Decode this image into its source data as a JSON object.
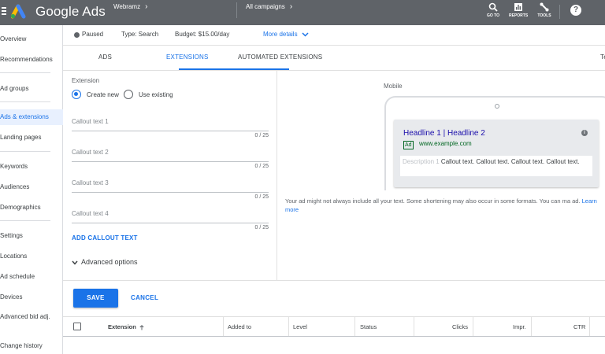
{
  "header": {
    "brand": "Google Ads",
    "account": "Webramz",
    "campaign": "All campaigns",
    "goto_label": "GO TO",
    "reports_label": "REPORTS",
    "tools_label": "TOOLS",
    "help_glyph": "?"
  },
  "sidebar": {
    "items": [
      {
        "label": "Overview"
      },
      {
        "label": "Recommendations"
      },
      {
        "label": "Ad groups"
      },
      {
        "label": "Ads & extensions"
      },
      {
        "label": "Landing pages"
      },
      {
        "label": "Keywords"
      },
      {
        "label": "Audiences"
      },
      {
        "label": "Demographics"
      },
      {
        "label": "Settings"
      },
      {
        "label": "Locations"
      },
      {
        "label": "Ad schedule"
      },
      {
        "label": "Devices"
      },
      {
        "label": "Advanced bid adj."
      },
      {
        "label": "Change history"
      }
    ]
  },
  "status": {
    "state": "Paused",
    "type": "Type: Search",
    "budget": "Budget: $15.00/day",
    "more_details": "More details"
  },
  "tabs": [
    {
      "label": "ADS"
    },
    {
      "label": "EXTENSIONS"
    },
    {
      "label": "AUTOMATED EXTENSIONS"
    },
    {
      "label": "Te"
    }
  ],
  "form": {
    "section_label": "Extension",
    "radio_create": "Create new",
    "radio_existing": "Use existing",
    "fields": [
      {
        "placeholder": "Callout text 1",
        "count": "0 / 25"
      },
      {
        "placeholder": "Callout text 2",
        "count": "0 / 25"
      },
      {
        "placeholder": "Callout text 3",
        "count": "0 / 25"
      },
      {
        "placeholder": "Callout text 4",
        "count": "0 / 25"
      }
    ],
    "add_callout": "ADD CALLOUT TEXT",
    "advanced": "Advanced options"
  },
  "preview": {
    "mode_label": "Mobile",
    "headline": "Headline 1 | Headline 2",
    "ad_badge": "Ad",
    "url": "www.example.com",
    "description_label": "Description 1",
    "callouts": "Callout text. Callout text. Callout text. Callout text.",
    "disclaimer": "Your ad might not always include all your text. Some shortening may also occur in some formats. You can ma ad.",
    "learn_more": "Learn more"
  },
  "actions": {
    "save": "SAVE",
    "cancel": "CANCEL"
  },
  "table": {
    "headers": [
      "Extension",
      "Added to",
      "Level",
      "Status",
      "Clicks",
      "Impr.",
      "CTR"
    ]
  },
  "colors": {
    "accent": "#1a73e8",
    "topbar": "#5f6368",
    "link_headline": "#1a0dab",
    "url_green": "#006621"
  }
}
